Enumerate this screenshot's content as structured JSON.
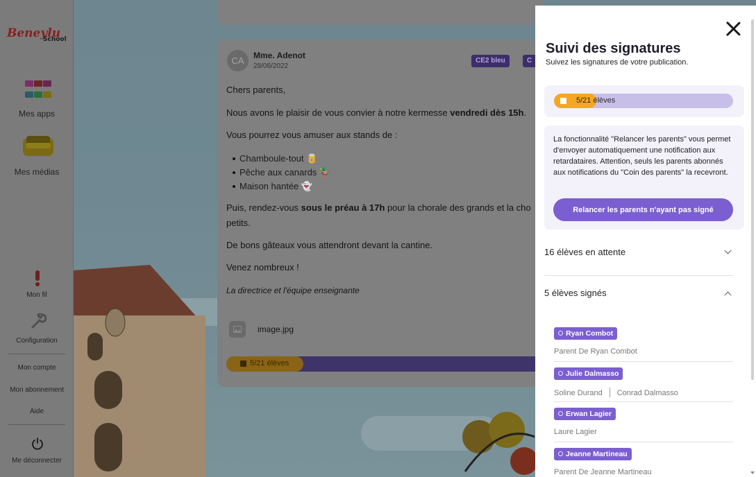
{
  "sidebar": {
    "logo_text": "Beneylu",
    "logo_sub": "School",
    "items": [
      {
        "label": "Mes apps"
      },
      {
        "label": "Mes médias"
      },
      {
        "label": "Mon fil"
      },
      {
        "label": "Configuration"
      },
      {
        "label": "Mon compte"
      },
      {
        "label": "Mon abonnement"
      },
      {
        "label": "Aide"
      },
      {
        "label": "Me déconnecter"
      }
    ],
    "apps_colors": [
      "#7a2d6a",
      "#6e2424",
      "#6d2451",
      "#2d5a6a",
      "#2b6d38",
      "#7a6d12"
    ]
  },
  "post": {
    "avatar": "CA",
    "author": "Mme. Adenot",
    "date": "28/06/2022",
    "tags": [
      "CE2 bleu",
      "C"
    ],
    "greeting": "Chers parents,",
    "p1_start": "Nous avons le plaisir de vous convier à notre kermesse ",
    "p1_bold": "vendredi dès 15h",
    "p1_end": ".",
    "p2": "Vous pourrez vous amuser aux stands de :",
    "bullets": [
      "Chamboule-tout 🥫",
      "Pêche aux canards 🦆",
      "Maison hantée 👻"
    ],
    "p3_start": "Puis, rendez-vous ",
    "p3_bold": "sous le préau à 17h",
    "p3_end": " pour la chorale des grands et la cho",
    "p3_line2": "petits.",
    "p4": "De bons gâteaux vous attendront devant la cantine.",
    "p5": "Venez nombreux !",
    "signature": "La directrice et l'équipe enseignante",
    "attachment": "image.jpg",
    "progress_label": "5/21 élèves",
    "progress_value": 0.238
  },
  "panel": {
    "title": "Suivi des signatures",
    "subtitle": "Suivez les signatures de votre publication.",
    "progress_label": "5/21 élèves",
    "progress_value": 0.238,
    "info": "La fonctionnalité \"Relancer les parents\" vous permet d'envoyer automatiquement une notification aux retardataires. Attention, seuls les parents abonnés aux notifications du \"Coin des parents\" la recevront.",
    "cta": "Relancer les parents n'ayant pas signé",
    "pending_label": "16 élèves en attente",
    "signed_label": "5 élèves signés",
    "signed": [
      {
        "student": "Ryan Combot",
        "parents": [
          "Parent De Ryan Combot"
        ]
      },
      {
        "student": "Julie Dalmasso",
        "parents": [
          "Soline Durand",
          "Conrad Dalmasso"
        ]
      },
      {
        "student": "Erwan Lagier",
        "parents": [
          "Laure Lagier"
        ]
      },
      {
        "student": "Jeanne Martineau",
        "parents": [
          "Parent De Jeanne Martineau"
        ]
      }
    ]
  },
  "colors": {
    "accent": "#7b5fd0",
    "progress_fill": "#f5a623",
    "progress_track": "#c8bfe9"
  }
}
